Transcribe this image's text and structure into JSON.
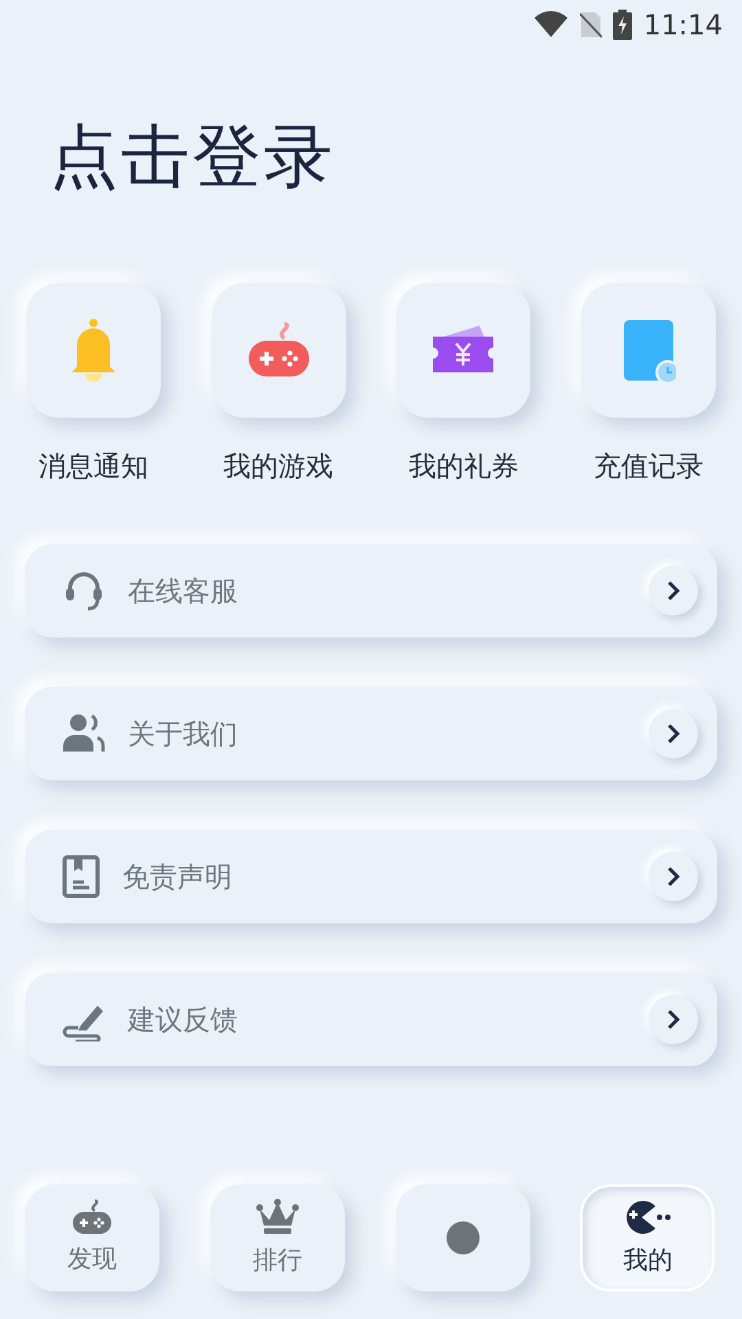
{
  "status_bar": {
    "time": "11:14"
  },
  "header": {
    "title": "点击登录"
  },
  "shortcuts": [
    {
      "kind": "bell",
      "label": "消息通知"
    },
    {
      "kind": "gamepad",
      "label": "我的游戏"
    },
    {
      "kind": "ticket",
      "label": "我的礼券"
    },
    {
      "kind": "record",
      "label": "充值记录"
    }
  ],
  "menu": [
    {
      "kind": "headset",
      "label": "在线客服"
    },
    {
      "kind": "users",
      "label": "关于我们"
    },
    {
      "kind": "document",
      "label": "免责声明"
    },
    {
      "kind": "pen",
      "label": "建议反馈"
    }
  ],
  "bottom_nav": [
    {
      "kind": "gamepad",
      "label": "发现",
      "selected": false
    },
    {
      "kind": "crown",
      "label": "排行",
      "selected": false
    },
    {
      "kind": "circle",
      "selected": false
    },
    {
      "kind": "pacman",
      "label": "我的",
      "selected": true
    }
  ]
}
